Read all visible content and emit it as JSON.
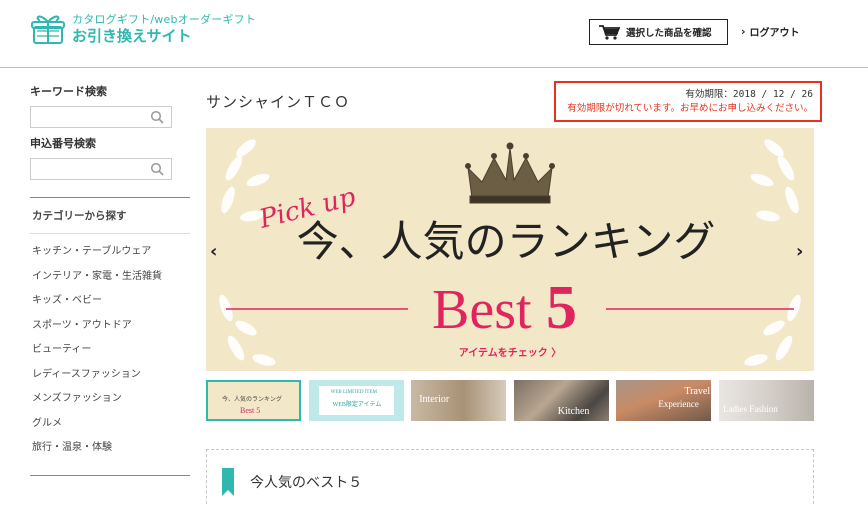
{
  "header": {
    "logo_line1": "カタログギフト/webオーダーギフト",
    "logo_line2": "お引き換えサイト",
    "cart_label": "選択した商品を確認",
    "logout_label": "ログアウト"
  },
  "sidebar": {
    "keyword_title": "キーワード検索",
    "keyword_placeholder": "",
    "number_title": "申込番号検索",
    "number_placeholder": "",
    "category_title": "カテゴリーから探す",
    "categories": [
      "キッチン・テーブルウェア",
      "インテリア・家電・生活雑貨",
      "キッズ・ベビー",
      "スポーツ・アウトドア",
      "ビューティー",
      "レディースファッション",
      "メンズファッション",
      "グルメ",
      "旅行・温泉・体験"
    ]
  },
  "main": {
    "shop_name": "サンシャインＴＣＯ",
    "expiry_date": "有効期限：2018 / 12 / 26",
    "expiry_warning": "有効期限が切れています。お早めにお申し込みください。",
    "banner": {
      "pickup": "Pick up",
      "headline": "今、人気のランキング",
      "best": "Best",
      "best_num": "5",
      "cta": "アイテムをチェック 〉"
    },
    "thumbs": [
      {
        "name": "ranking",
        "label1": "今、人気のランキング",
        "label2": "Best 5"
      },
      {
        "name": "web-limited",
        "label1": "WEB LIMITED ITEM",
        "label2": "WEB限定アイテム"
      },
      {
        "name": "interior",
        "label1": "Interior",
        "label2": ""
      },
      {
        "name": "kitchen",
        "label1": "Kitchen",
        "label2": ""
      },
      {
        "name": "travel",
        "label1": "Travel",
        "label2": "Experience"
      },
      {
        "name": "ladies",
        "label1": "Ladies Fashion",
        "label2": ""
      }
    ],
    "best_section_title": "今人気のベスト５"
  },
  "colors": {
    "brand": "#30b8b0",
    "alert": "#e8321e",
    "banner_bg": "#f2e8c7",
    "accent_pink": "#e0245e"
  }
}
